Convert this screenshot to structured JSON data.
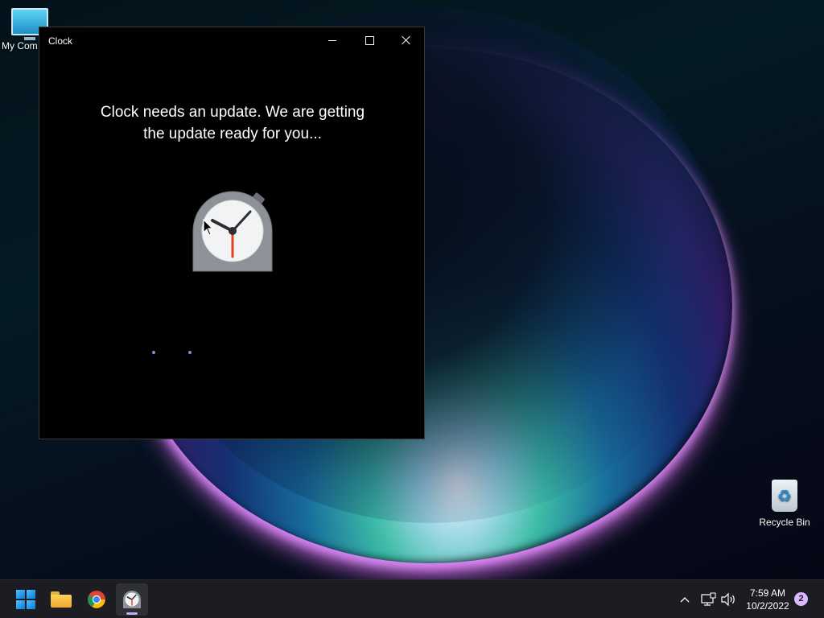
{
  "desktop": {
    "icons": [
      {
        "label": "My Com",
        "icon": "computer-icon"
      },
      {
        "label": "Recycle Bin",
        "icon": "recycle-bin-icon"
      }
    ]
  },
  "window": {
    "title": "Clock",
    "controls": {
      "minimize": "minimize-icon",
      "maximize": "maximize-icon",
      "close": "close-icon"
    },
    "message_line1": "Clock needs an update. We are getting",
    "message_line2": "the update ready for you...",
    "app_icon": "clock-app-icon"
  },
  "taskbar": {
    "pinned": [
      {
        "name": "Start",
        "icon": "windows-start-icon"
      },
      {
        "name": "File Explorer",
        "icon": "folder-icon"
      },
      {
        "name": "Google Chrome",
        "icon": "chrome-icon"
      },
      {
        "name": "Clock",
        "icon": "clock-app-icon",
        "active": true
      }
    ],
    "tray": {
      "icons": [
        "chevron-up-icon",
        "network-icon",
        "volume-icon"
      ],
      "time": "7:59 AM",
      "date": "10/2/2022",
      "notifications": "2"
    }
  },
  "colors": {
    "accent": "#0f78d4",
    "taskbar": "#1c1d22",
    "window_bg": "#000000",
    "clock_hand": "#e8401c",
    "loading_dot": "#b07ad0",
    "notification_badge": "#d9b8ff"
  }
}
